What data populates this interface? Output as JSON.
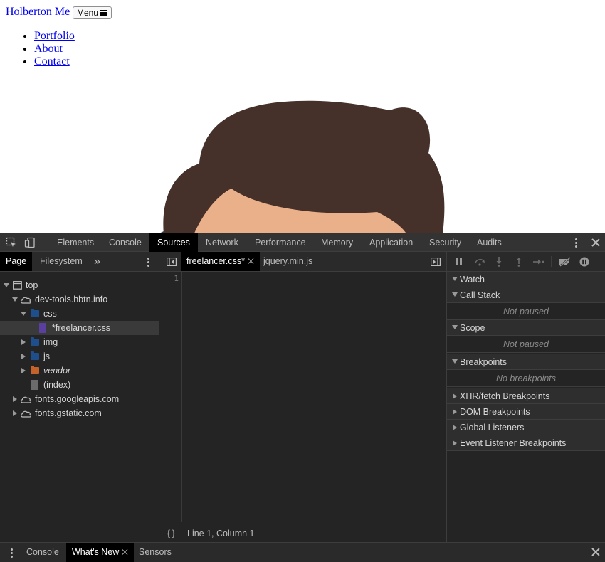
{
  "site": {
    "brand": "Holberton Me",
    "menu_button": "Menu",
    "nav": [
      "Portfolio",
      "About",
      "Contact"
    ]
  },
  "devtools": {
    "main_tabs": [
      "Elements",
      "Console",
      "Sources",
      "Network",
      "Performance",
      "Memory",
      "Application",
      "Security",
      "Audits"
    ],
    "active_main_tab": "Sources",
    "navigator": {
      "tabs": [
        "Page",
        "Filesystem"
      ],
      "more": "»",
      "tree": {
        "top": "top",
        "domain": "dev-tools.hbtn.info",
        "css": "css",
        "file_selected": "*freelancer.css",
        "img": "img",
        "js": "js",
        "vendor": "vendor",
        "index": "(index)",
        "fonts1": "fonts.googleapis.com",
        "fonts2": "fonts.gstatic.com"
      }
    },
    "editor": {
      "tabs": [
        "freelancer.css*",
        "jquery.min.js"
      ],
      "line_number": "1",
      "pretty_print": "{}",
      "status": "Line 1, Column 1"
    },
    "debugger": {
      "watch": "Watch",
      "call_stack": "Call Stack",
      "call_stack_body": "Not paused",
      "scope": "Scope",
      "scope_body": "Not paused",
      "breakpoints": "Breakpoints",
      "breakpoints_body": "No breakpoints",
      "xhr": "XHR/fetch Breakpoints",
      "dom": "DOM Breakpoints",
      "global": "Global Listeners",
      "event": "Event Listener Breakpoints"
    },
    "drawer_tabs": [
      "Console",
      "What's New",
      "Sensors"
    ]
  },
  "colors": {
    "hair": "#45302a",
    "face": "#eab08a",
    "shirt": "#2c3e50",
    "folder_blue": "#1e4f8c",
    "folder_orange": "#c5622a",
    "css_file": "#5a3fa0"
  }
}
